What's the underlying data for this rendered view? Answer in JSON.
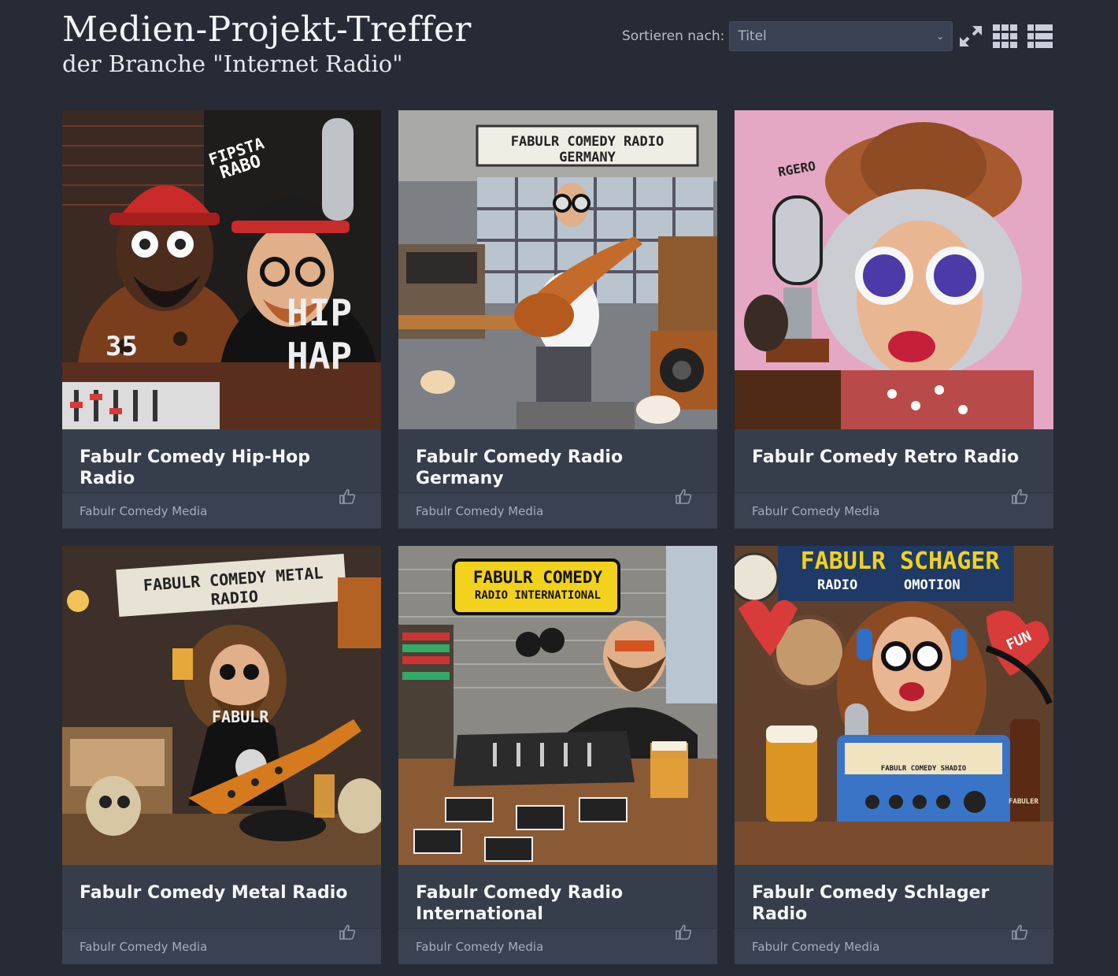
{
  "header": {
    "title": "Medien-Projekt-Treffer",
    "subtitle": "der Branche \"Internet Radio\""
  },
  "toolbar": {
    "sort_label": "Sortieren nach:",
    "sort_value": "Titel",
    "icons": [
      "expand-icon",
      "grid-view-icon",
      "list-view-icon"
    ]
  },
  "cards": [
    {
      "title": "Fabulr Comedy Hip-Hop Radio",
      "publisher": "Fabulr Comedy Media",
      "image_text": [
        "FIPSTA",
        "RABO",
        "35",
        "HIP",
        "HAP"
      ],
      "palette": [
        "#5a2e1e",
        "#c92a2a",
        "#e8b24a"
      ]
    },
    {
      "title": "Fabulr Comedy Radio Germany",
      "publisher": "Fabulr Comedy Media",
      "image_text": [
        "FABULR COMEDY RADIO GERMANY"
      ],
      "palette": [
        "#6d6f72",
        "#b46a32",
        "#d9d5cc"
      ]
    },
    {
      "title": "Fabulr Comedy Retro Radio",
      "publisher": "Fabulr Comedy Media",
      "image_text": [
        "RGERO"
      ],
      "palette": [
        "#e7a9c7",
        "#8a4f2c",
        "#cfd2d8"
      ]
    },
    {
      "title": "Fabulr Comedy Metal Radio",
      "publisher": "Fabulr Comedy Media",
      "image_text": [
        "FABULR COMEDY METAL RADIO",
        "FABULR"
      ],
      "palette": [
        "#3a2b22",
        "#c46b1e",
        "#d9cbb4"
      ]
    },
    {
      "title": "Fabulr Comedy Radio International",
      "publisher": "Fabulr Comedy Media",
      "image_text": [
        "FABULR COMEDY",
        "RADIO INTERNATIONAL"
      ],
      "palette": [
        "#7c7b78",
        "#f2d21a",
        "#8a5a34"
      ]
    },
    {
      "title": "Fabulr Comedy Schlager Radio",
      "publisher": "Fabulr Comedy Media",
      "image_text": [
        "FABULR SCHAGER",
        "RADIO",
        "OMOTION",
        "FUN",
        "FABULR COMEDY SHADIO",
        "FABULER"
      ],
      "palette": [
        "#6a4630",
        "#d93a3a",
        "#3a74c6"
      ]
    }
  ]
}
